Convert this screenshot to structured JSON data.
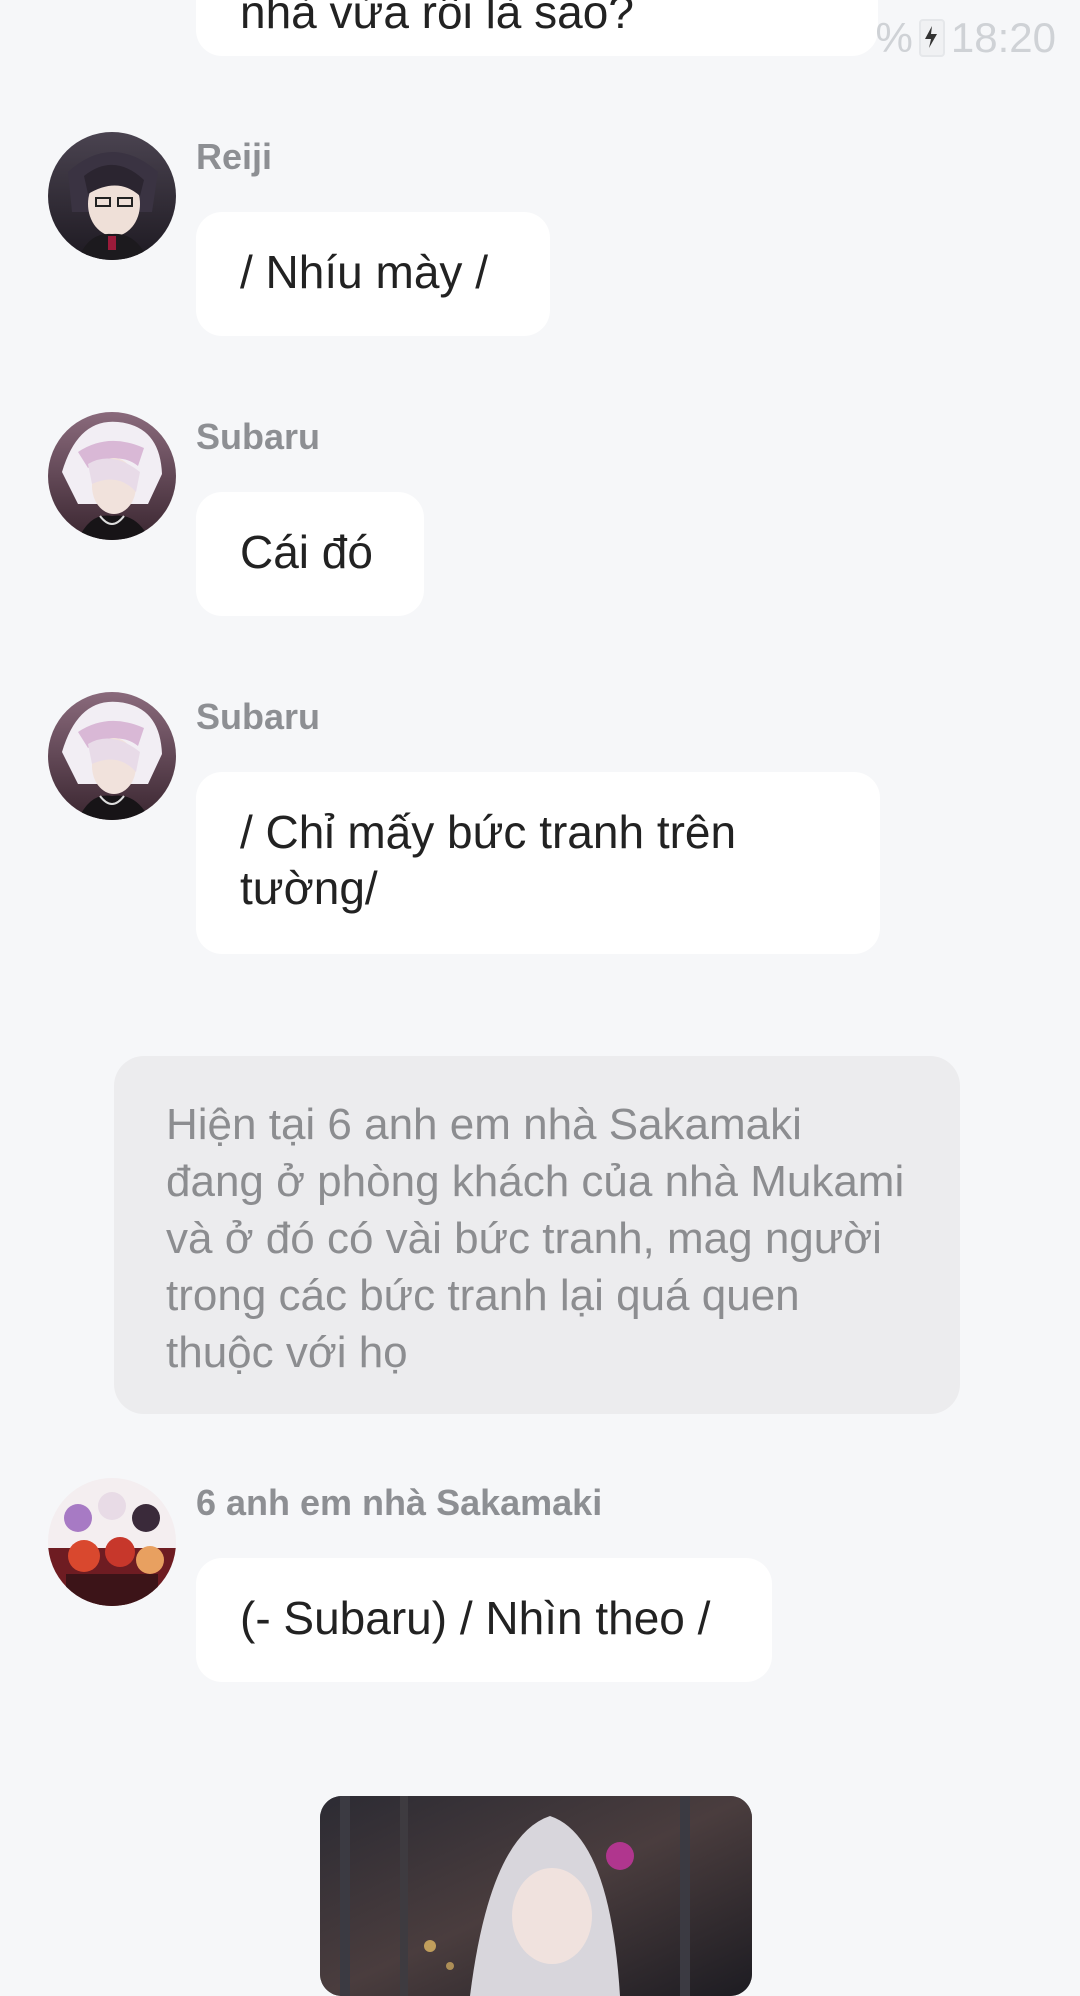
{
  "status": {
    "time": "18:20",
    "battery_partial": "%"
  },
  "messages": [
    {
      "id": "top",
      "text": "nhà vừa rồi là sao?"
    },
    {
      "id": "reiji",
      "sender": "Reiji",
      "text": "/ Nhíu mày /"
    },
    {
      "id": "subaru1",
      "sender": "Subaru",
      "text": "Cái đó"
    },
    {
      "id": "subaru2",
      "sender": "Subaru",
      "text": "/ Chỉ mấy bức tranh trên tường/"
    }
  ],
  "narration": "Hiện tại 6 anh em nhà Sakamaki đang ở phòng khách của nhà Mukami và ở đó có vài bức tranh, mag người trong các bức tranh lại quá quen thuộc với họ",
  "group_message": {
    "sender": "6 anh em nhà Sakamaki",
    "text": "(- Subaru) / Nhìn theo /"
  }
}
